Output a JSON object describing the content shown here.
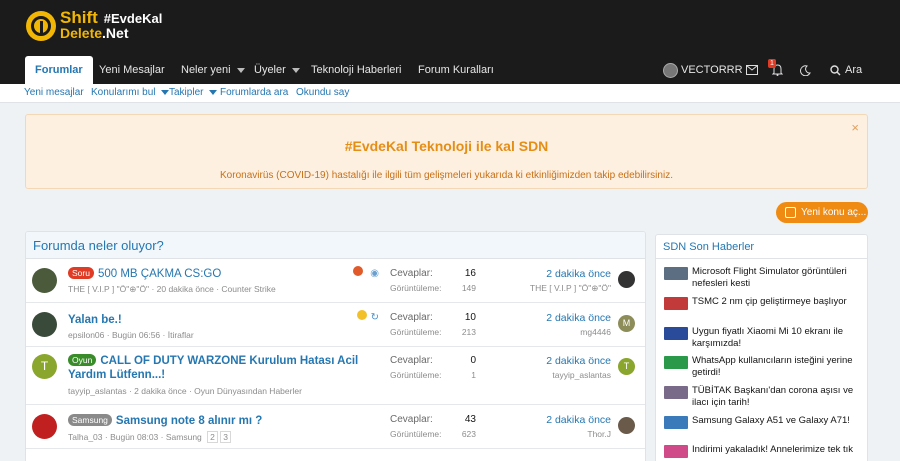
{
  "brand": {
    "line1": "Shift",
    "hashtag": "#EvdeKal",
    "line2a": "Delete",
    "line2b": ".Net"
  },
  "nav": {
    "tabs": [
      "Forumlar",
      "Yeni Mesajlar",
      "Neler yeni",
      "Üyeler",
      "Teknoloji Haberleri",
      "Forum Kuralları"
    ],
    "user": "VECTORRR",
    "alert_count": "1",
    "search": "Ara"
  },
  "subnav": [
    "Yeni mesajlar",
    "Konularımı bul",
    "Takipler",
    "Forumlarda ara",
    "Okundu say"
  ],
  "notice": {
    "title": "#EvdeKal Teknoloji ile kal SDN",
    "text": "Koronavirüs (COVID-19) hastalığı ile ilgili tüm gelişmeleri yukarıda ki etkinliğimizden takip edebilirsiniz.",
    "close": "×"
  },
  "new_thread_button": "Yeni konu aç...",
  "main": {
    "title": "Forumda neler oluyor?",
    "labels": {
      "replies": "Cevaplar:",
      "views": "Görüntüleme:"
    },
    "threads": [
      {
        "prefix": "Soru",
        "prefix_color": "#e03b24",
        "title": "500 MB ÇAKMA CS:GO",
        "author": "THE [ V.I.P ] \"Ö\"⊕\"Ö\"",
        "time": "20 dakika önce",
        "forum": "Counter Strike",
        "replies": "16",
        "views": "149",
        "last_time": "2 dakika önce",
        "last_user": "THE [ V.I.P ] \"Ö\"⊕\"Ö\"",
        "avatar_color": "#4a5a3a",
        "last_avatar_color": "#333"
      },
      {
        "prefix": "",
        "prefix_color": "",
        "title": "Yalan be.!",
        "author": "epsilon06",
        "time": "Bugün 06:56",
        "forum": "İtiraflar",
        "replies": "10",
        "views": "213",
        "last_time": "2 dakika önce",
        "last_user": "mg4446",
        "avatar_color": "#3a4a3a",
        "last_avatar_color": "#8d8d5a",
        "last_avatar_letter": "M"
      },
      {
        "prefix": "Oyun",
        "prefix_color": "#3a8c2a",
        "title": "CALL OF DUTY WARZONE Kurulum Hatası Acil Yardım Lütfenn...!",
        "author": "tayyip_aslantas",
        "time": "2 dakika önce",
        "forum": "Oyun Dünyasından Haberler",
        "replies": "0",
        "views": "1",
        "last_time": "2 dakika önce",
        "last_user": "tayyip_aslantas",
        "avatar_color": "#8aa62c",
        "avatar_letter": "T",
        "last_avatar_color": "#8aa62c",
        "last_avatar_letter": "T"
      },
      {
        "prefix": "Samsung",
        "prefix_color": "#8a8a8a",
        "title": "Samsung note 8 alınır mı ?",
        "author": "Talha_03",
        "time": "Bugün 08:03",
        "forum": "Samsung",
        "pages": [
          "2",
          "3"
        ],
        "replies": "43",
        "views": "623",
        "last_time": "2 dakika önce",
        "last_user": "Thor.J",
        "avatar_color": "#c02020",
        "last_avatar_color": "#6a5a4a"
      }
    ]
  },
  "side": {
    "title": "SDN Son Haberler",
    "items": [
      {
        "text": "Microsoft Flight Simulator görüntüleri nefesleri kesti",
        "thumb": "#5c6f82"
      },
      {
        "text": "TSMC 2 nm çip geliştirmeye başlıyor",
        "thumb": "#c23a3a"
      },
      {
        "text": "Uygun fiyatlı Xiaomi Mi 10 ekranı ile karşımızda!",
        "thumb": "#2a4a9a"
      },
      {
        "text": "WhatsApp kullanıcıların isteğini yerine getirdi!",
        "thumb": "#2a9a4a"
      },
      {
        "text": "TÜBİTAK Başkanı'dan corona aşısı ve ilacı için tarih!",
        "thumb": "#7a6a8a"
      },
      {
        "text": "Samsung Galaxy A51 ve Galaxy A71!",
        "thumb": "#3a7aba"
      },
      {
        "text": "Indirimi yakaladık! Annelerimize tek tık",
        "thumb": "#d04a8a"
      }
    ]
  }
}
